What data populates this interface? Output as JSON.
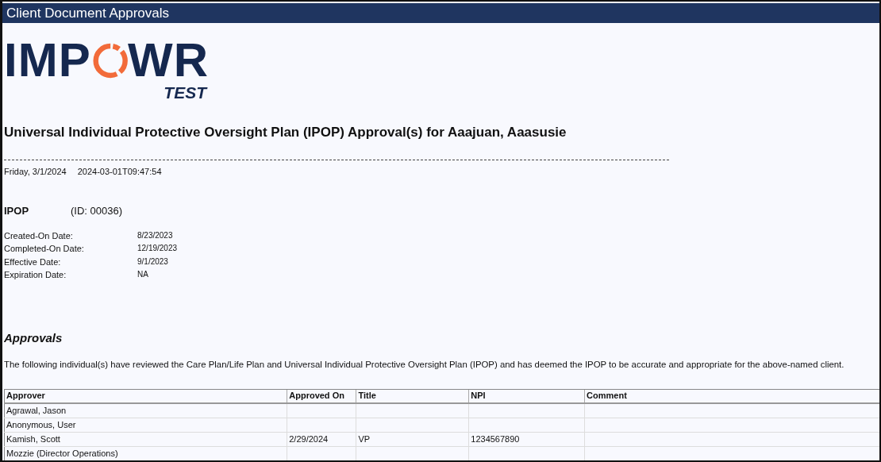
{
  "window": {
    "title": "Client Document Approvals"
  },
  "logo": {
    "text_left": "IMP",
    "text_right": "WR",
    "subtitle": "TEST"
  },
  "heading": "Universal Individual Protective Oversight Plan (IPOP) Approval(s) for Aaajuan, Aaasusie",
  "timestamp": {
    "date": "Friday, 3/1/2024",
    "datetime": "2024-03-01T09:47:54"
  },
  "document": {
    "type": "IPOP",
    "id": "(ID: 00036)",
    "fields": [
      {
        "label": "Created-On Date:",
        "value": "8/23/2023"
      },
      {
        "label": "Completed-On Date:",
        "value": "12/19/2023"
      },
      {
        "label": "Effective Date:",
        "value": "9/1/2023"
      },
      {
        "label": "Expiration Date:",
        "value": "NA"
      }
    ]
  },
  "approvals": {
    "title": "Approvals",
    "description": "The following individual(s) have reviewed the Care Plan/Life Plan and Universal Individual Protective Oversight Plan (IPOP) and has deemed the IPOP to be accurate and appropriate for the above-named client.",
    "table": {
      "columns": [
        "Approver",
        "Approved On",
        "Title",
        "NPI",
        "Comment"
      ],
      "rows": [
        {
          "approver": "Agrawal, Jason"
        },
        {
          "approver": "Anonymous, User"
        },
        {
          "approver": "Kamish, Scott",
          "approved_on": "2/29/2024",
          "title": "VP",
          "npi": "1234567890"
        },
        {
          "approver": "Mozzie (Director Operations)"
        }
      ]
    }
  }
}
